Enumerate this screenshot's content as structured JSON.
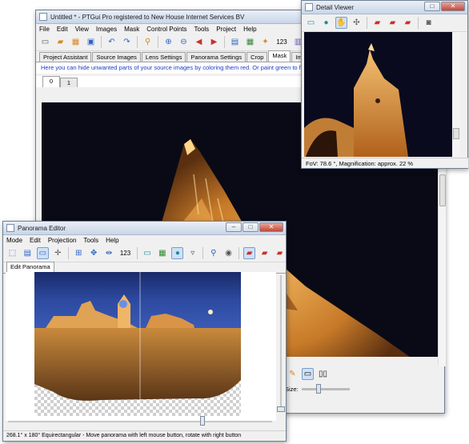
{
  "main_window": {
    "title": "Untitled * - PTGui Pro registered to New House Internet Services BV",
    "menu": [
      "File",
      "Edit",
      "View",
      "Images",
      "Mask",
      "Control Points",
      "Tools",
      "Project",
      "Help"
    ],
    "toolbar_zoom_value": "123",
    "tabs": [
      "Project Assistant",
      "Source Images",
      "Lens Settings",
      "Panorama Settings",
      "Crop",
      "Mask",
      "Image Param"
    ],
    "active_tab": "Mask",
    "hint": "Here you can hide unwanted parts of your source images by coloring them red. Or paint green to force i",
    "image_tabs": [
      "0",
      "1"
    ],
    "zoom_label": "Size:"
  },
  "detail_viewer": {
    "title": "Detail Viewer",
    "status": "FoV: 78.6 °, Magnification: approx. 22 %"
  },
  "panorama_editor": {
    "title": "Panorama Editor",
    "menu": [
      "Mode",
      "Edit",
      "Projection",
      "Tools",
      "Help"
    ],
    "toolbar_zoom_value": "123",
    "tab": "Edit Panorama",
    "status": "268.1° x 180° Equirectangular - Move panorama with left mouse button, rotate with right button"
  },
  "window_controls": {
    "minimize": "–",
    "maximize": "□",
    "close": "✕"
  },
  "colors": {
    "accent": "#2b63c6",
    "hint_text": "#1a3ec2",
    "mask_red": "#c8322a"
  }
}
